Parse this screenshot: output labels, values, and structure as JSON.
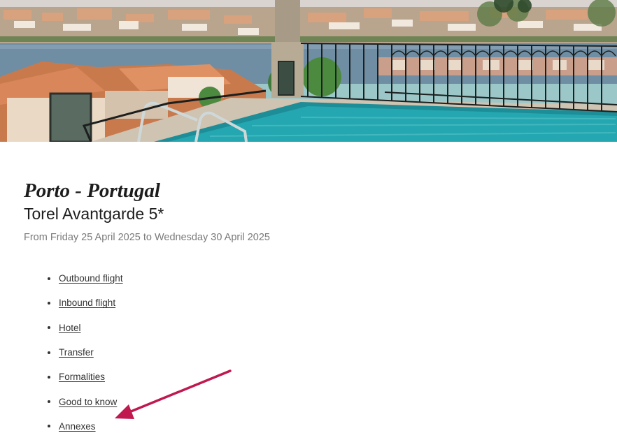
{
  "hero": {
    "image_icon": "porto-pool-photo"
  },
  "trip": {
    "destination": "Porto - Portugal",
    "hotel": "Torel Avantgarde 5*",
    "dates": "From Friday 25 April 2025 to Wednesday 30 April 2025"
  },
  "menu": {
    "items": [
      {
        "label": "Outbound flight"
      },
      {
        "label": "Inbound flight"
      },
      {
        "label": "Hotel"
      },
      {
        "label": "Transfer"
      },
      {
        "label": "Formalities"
      },
      {
        "label": "Good to know"
      },
      {
        "label": "Annexes"
      }
    ]
  },
  "colors": {
    "annotation_arrow": "#c0184f",
    "link": "#333333",
    "subtitle": "#7a7a7a"
  }
}
